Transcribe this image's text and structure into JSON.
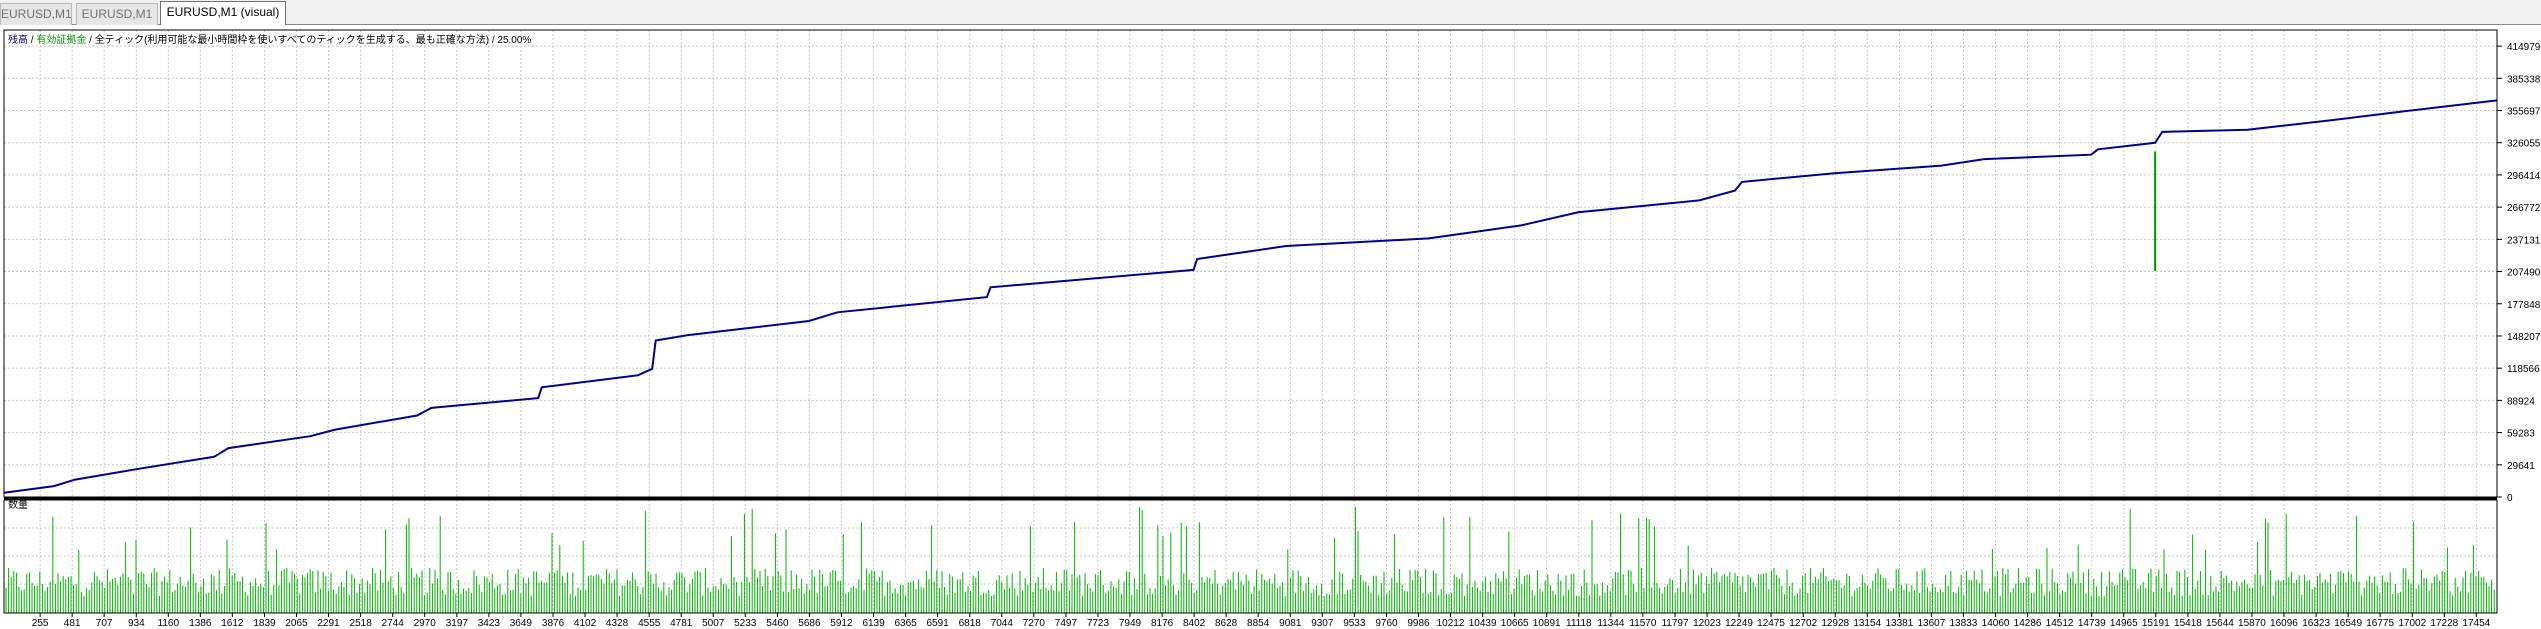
{
  "tabs": [
    {
      "label": "EURUSD,M1",
      "active": false
    },
    {
      "label": "EURUSD,M1",
      "active": false
    },
    {
      "label": "EURUSD,M1 (visual)",
      "active": true
    }
  ],
  "info": {
    "balance": "残高",
    "sep1": " / ",
    "equity": "有効証拠金",
    "sep2": " / ",
    "model": "全ティック(利用可能な最小時間枠を使いすべてのティックを生成する、最も正確な方法)",
    "sep3": " / ",
    "quality": "25.00%"
  },
  "volume_label": "数量",
  "colors": {
    "balance": "#00008b",
    "equity": "#009900",
    "volume": "#00b300",
    "grid": "#c8c8c8",
    "frame": "#000000"
  },
  "chart_data": [
    {
      "type": "line",
      "y_ticks": [
        0,
        29641,
        59283,
        88924,
        118566,
        148207,
        177848,
        207490,
        237131,
        266772,
        296414,
        326055,
        355697,
        385338,
        414979
      ],
      "ylim": [
        0,
        429800
      ],
      "xlim": [
        0,
        17600
      ],
      "grid": true,
      "series": [
        {
          "name": "残高",
          "points": [
            [
              0,
              4000
            ],
            [
              700,
              10000
            ],
            [
              1000,
              16000
            ],
            [
              1900,
              26000
            ],
            [
              2950,
              37000
            ],
            [
              3150,
              45000
            ],
            [
              4300,
              56000
            ],
            [
              4650,
              62000
            ],
            [
              5800,
              75000
            ],
            [
              6000,
              82000
            ],
            [
              7500,
              91000
            ],
            [
              7550,
              101000
            ],
            [
              8900,
              112000
            ],
            [
              9100,
              118000
            ],
            [
              9150,
              144000
            ],
            [
              9600,
              149000
            ],
            [
              11300,
              162000
            ],
            [
              11700,
              170000
            ],
            [
              13800,
              184000
            ],
            [
              13850,
              193000
            ],
            [
              16700,
              209000
            ],
            [
              16750,
              219000
            ],
            [
              18000,
              231000
            ],
            [
              20000,
              238000
            ],
            [
              21300,
              250000
            ],
            [
              22100,
              262000
            ],
            [
              23800,
              273000
            ],
            [
              24300,
              282000
            ],
            [
              24400,
              290000
            ],
            [
              25700,
              298000
            ],
            [
              27200,
              305000
            ],
            [
              27800,
              311000
            ],
            [
              29300,
              315000
            ],
            [
              29400,
              320000
            ],
            [
              30200,
              326000
            ],
            [
              30300,
              336000
            ],
            [
              31500,
              338000
            ],
            [
              32700,
              347000
            ],
            [
              33700,
              355000
            ],
            [
              35000,
              365000
            ]
          ]
        },
        {
          "name": "有効証拠金",
          "spikes": [
            [
              30200,
              318000,
              208000
            ]
          ]
        }
      ]
    },
    {
      "type": "bar",
      "name": "数量",
      "x_ticks": [
        255,
        481,
        707,
        934,
        1160,
        1386,
        1612,
        1839,
        2065,
        2291,
        2518,
        2744,
        2970,
        3197,
        3423,
        3649,
        3876,
        4102,
        4328,
        4555,
        4781,
        5007,
        5233,
        5460,
        5686,
        5912,
        6139,
        6365,
        6591,
        6818,
        7044,
        7270,
        7497,
        7723,
        7949,
        8176,
        8402,
        8628,
        8854,
        9081,
        9307,
        9533,
        9760,
        9986,
        10212,
        10439,
        10665,
        10891,
        11118,
        11344,
        11570,
        11797,
        12023,
        12249,
        12475,
        12702,
        12928,
        13154,
        13381,
        13607,
        13833,
        14060,
        14286,
        14512,
        14739,
        14965,
        15191,
        15418,
        15644,
        15870,
        16096,
        16323,
        16549,
        16775,
        17002,
        17228,
        17454
      ],
      "xlim": [
        0,
        17600
      ],
      "typical_values": [
        0.15,
        0.25,
        0.4
      ],
      "peak_values": [
        0.55,
        0.75,
        0.95
      ]
    }
  ]
}
